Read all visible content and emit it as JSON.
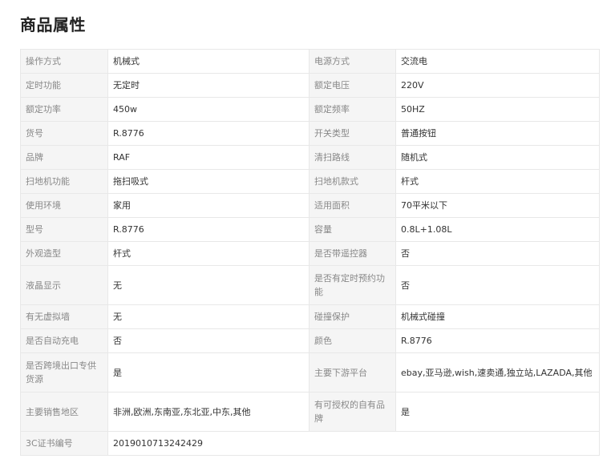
{
  "heading": "商品属性",
  "rows": [
    {
      "k1": "操作方式",
      "v1": "机械式",
      "k2": "电源方式",
      "v2": "交流电"
    },
    {
      "k1": "定时功能",
      "v1": "无定时",
      "k2": "额定电压",
      "v2": "220V"
    },
    {
      "k1": "额定功率",
      "v1": "450w",
      "k2": "额定频率",
      "v2": "50HZ"
    },
    {
      "k1": "货号",
      "v1": "R.8776",
      "k2": "开关类型",
      "v2": "普通按钮"
    },
    {
      "k1": "品牌",
      "v1": "RAF",
      "k2": "清扫路线",
      "v2": "随机式"
    },
    {
      "k1": "扫地机功能",
      "v1": "拖扫吸式",
      "k2": "扫地机款式",
      "v2": "杆式"
    },
    {
      "k1": "使用环境",
      "v1": "家用",
      "k2": "适用面积",
      "v2": "70平米以下"
    },
    {
      "k1": "型号",
      "v1": "R.8776",
      "k2": "容量",
      "v2": "0.8L+1.08L"
    },
    {
      "k1": "外观造型",
      "v1": "杆式",
      "k2": "是否带遥控器",
      "v2": "否"
    },
    {
      "k1": "液晶显示",
      "v1": "无",
      "k2": "是否有定时预约功能",
      "v2": "否"
    },
    {
      "k1": "有无虚拟墙",
      "v1": "无",
      "k2": "碰撞保护",
      "v2": "机械式碰撞"
    },
    {
      "k1": "是否自动充电",
      "v1": "否",
      "k2": "颜色",
      "v2": "R.8776"
    },
    {
      "k1": "是否跨境出口专供货源",
      "v1": "是",
      "k2": "主要下游平台",
      "v2": "ebay,亚马逊,wish,速卖通,独立站,LAZADA,其他"
    },
    {
      "k1": "主要销售地区",
      "v1": "非洲,欧洲,东南亚,东北亚,中东,其他",
      "k2": "有可授权的自有品牌",
      "v2": "是"
    },
    {
      "k1": "3C证书编号",
      "v1": "2019010713242429"
    }
  ]
}
